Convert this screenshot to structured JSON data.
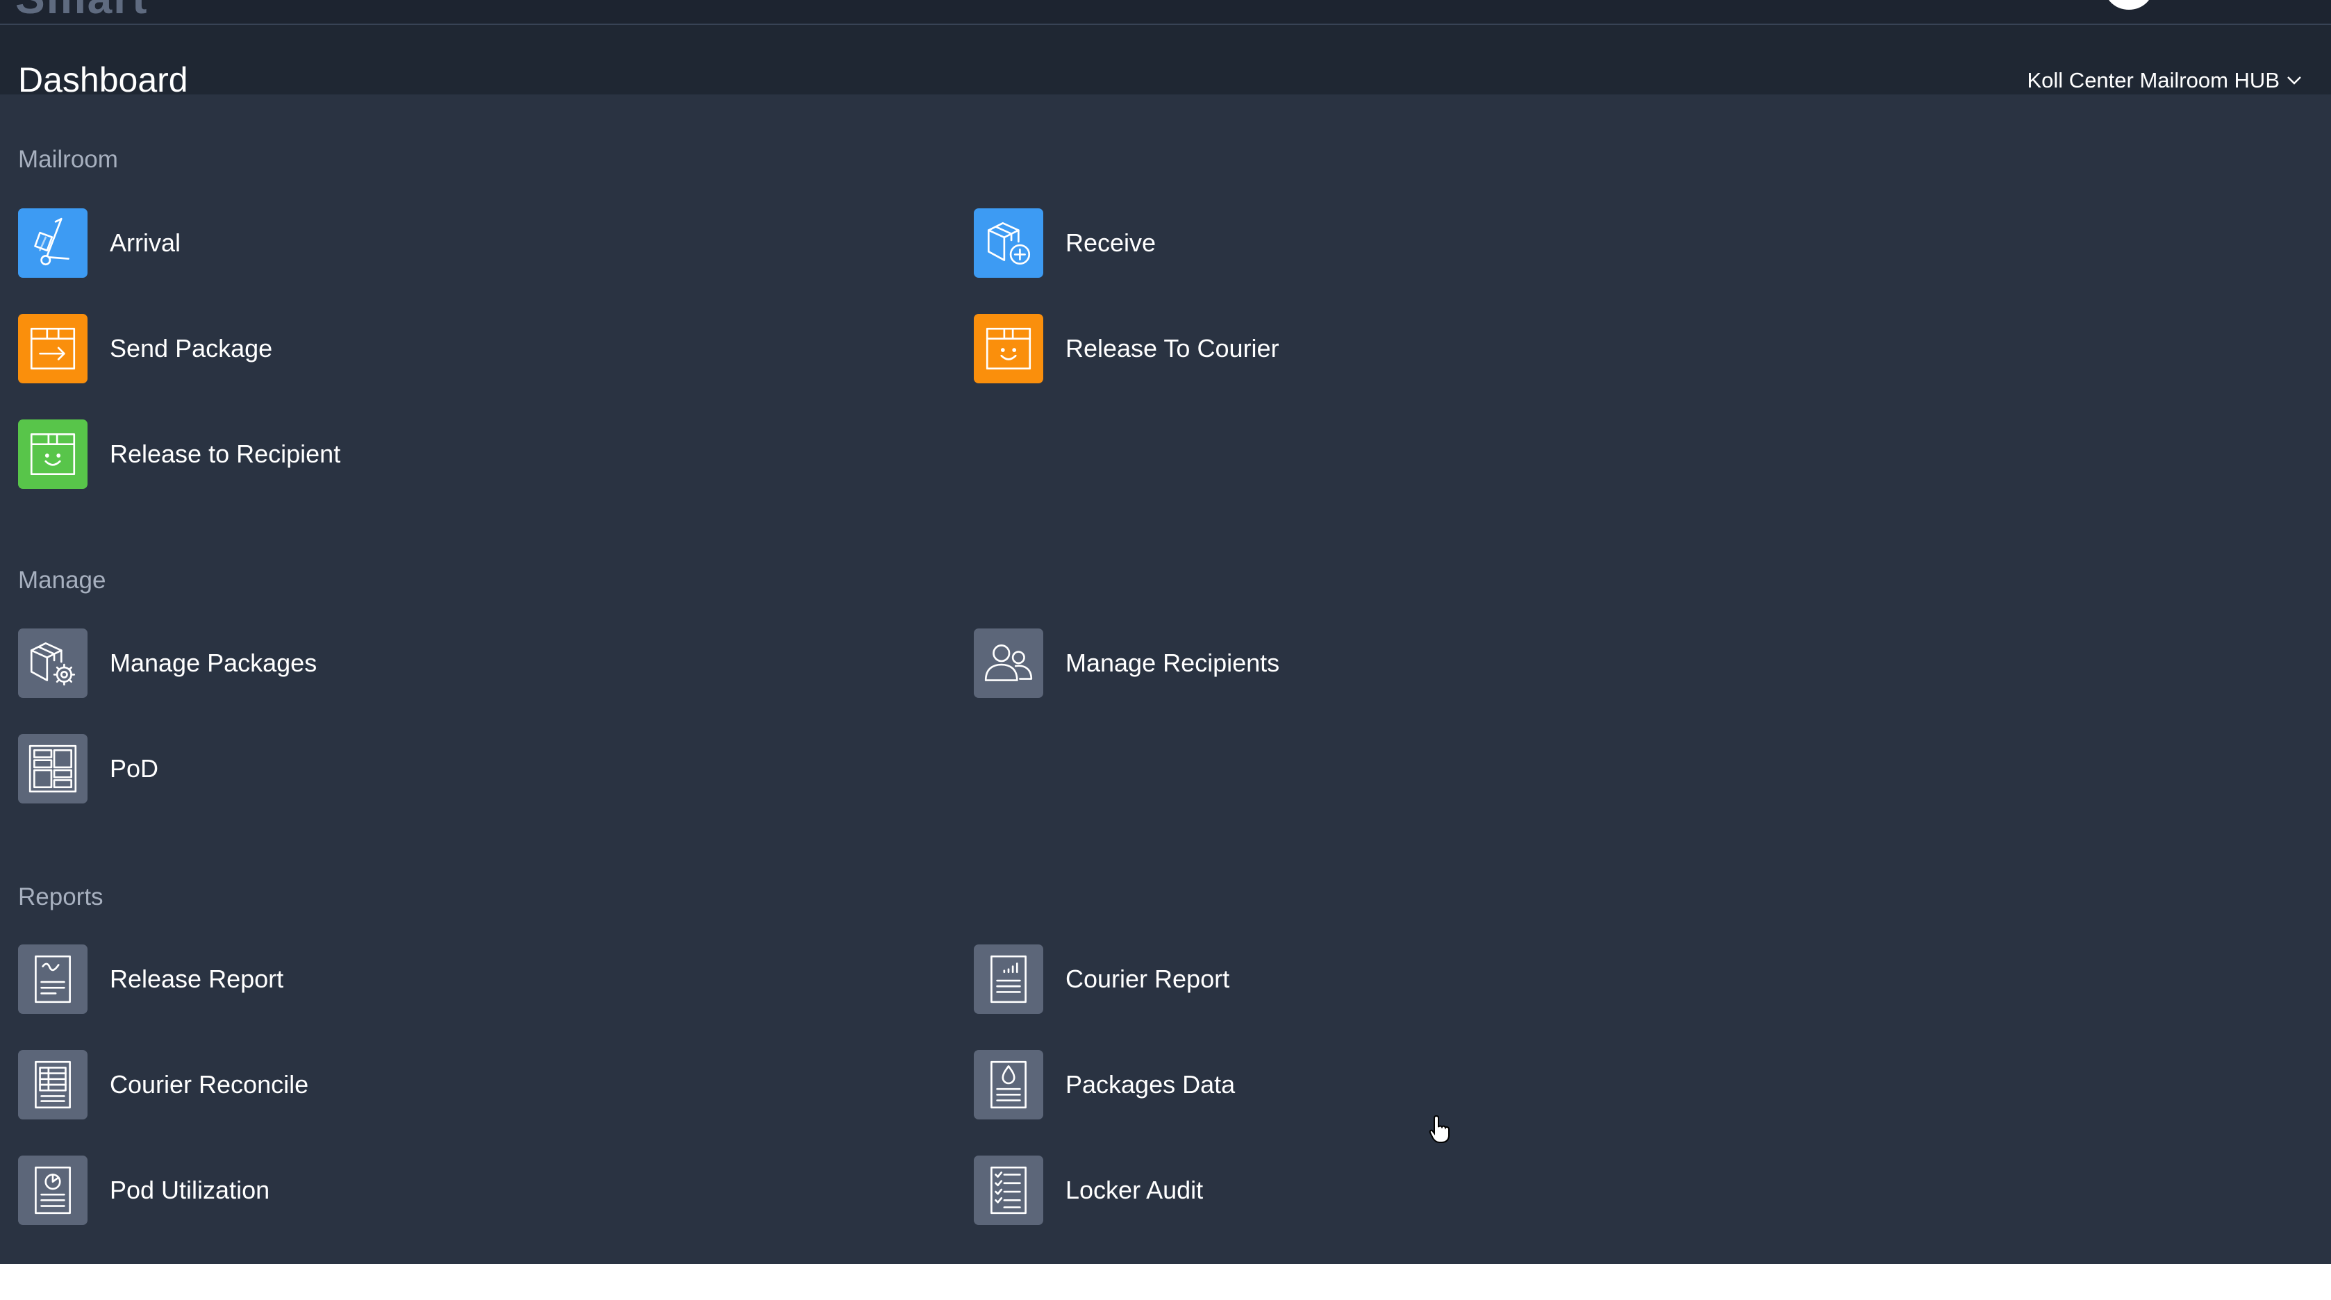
{
  "header": {
    "logo_text": "Smart",
    "page_title": "Dashboard",
    "location": "Koll Center Mailroom HUB"
  },
  "colors": {
    "background": "#2a3342",
    "header": "#1f2733",
    "blue": "#3d9bf3",
    "orange": "#fa8f0c",
    "green": "#58c54a",
    "gray": "#5c6679"
  },
  "sections": [
    {
      "title": "Mailroom",
      "items": [
        {
          "label": "Arrival",
          "icon": "hand-truck-icon",
          "color": "blue"
        },
        {
          "label": "Receive",
          "icon": "box-plus-icon",
          "color": "blue"
        },
        {
          "label": "Send Package",
          "icon": "box-arrow-icon",
          "color": "orange"
        },
        {
          "label": "Release To Courier",
          "icon": "box-smile-icon",
          "color": "orange"
        },
        {
          "label": "Release to Recipient",
          "icon": "box-smile-icon",
          "color": "green"
        }
      ]
    },
    {
      "title": "Manage",
      "items": [
        {
          "label": "Manage Packages",
          "icon": "box-gear-icon",
          "color": "gray"
        },
        {
          "label": "Manage Recipients",
          "icon": "users-icon",
          "color": "gray"
        },
        {
          "label": "PoD",
          "icon": "locker-grid-icon",
          "color": "gray"
        }
      ]
    },
    {
      "title": "Reports",
      "items": [
        {
          "label": "Release Report",
          "icon": "report-doc-icon",
          "color": "gray"
        },
        {
          "label": "Courier Report",
          "icon": "report-chart-icon",
          "color": "gray"
        },
        {
          "label": "Courier Reconcile",
          "icon": "report-table-icon",
          "color": "gray"
        },
        {
          "label": "Packages Data",
          "icon": "report-drop-icon",
          "color": "gray"
        },
        {
          "label": "Pod Utilization",
          "icon": "report-pie-icon",
          "color": "gray"
        },
        {
          "label": "Locker Audit",
          "icon": "checklist-icon",
          "color": "gray"
        }
      ]
    }
  ]
}
